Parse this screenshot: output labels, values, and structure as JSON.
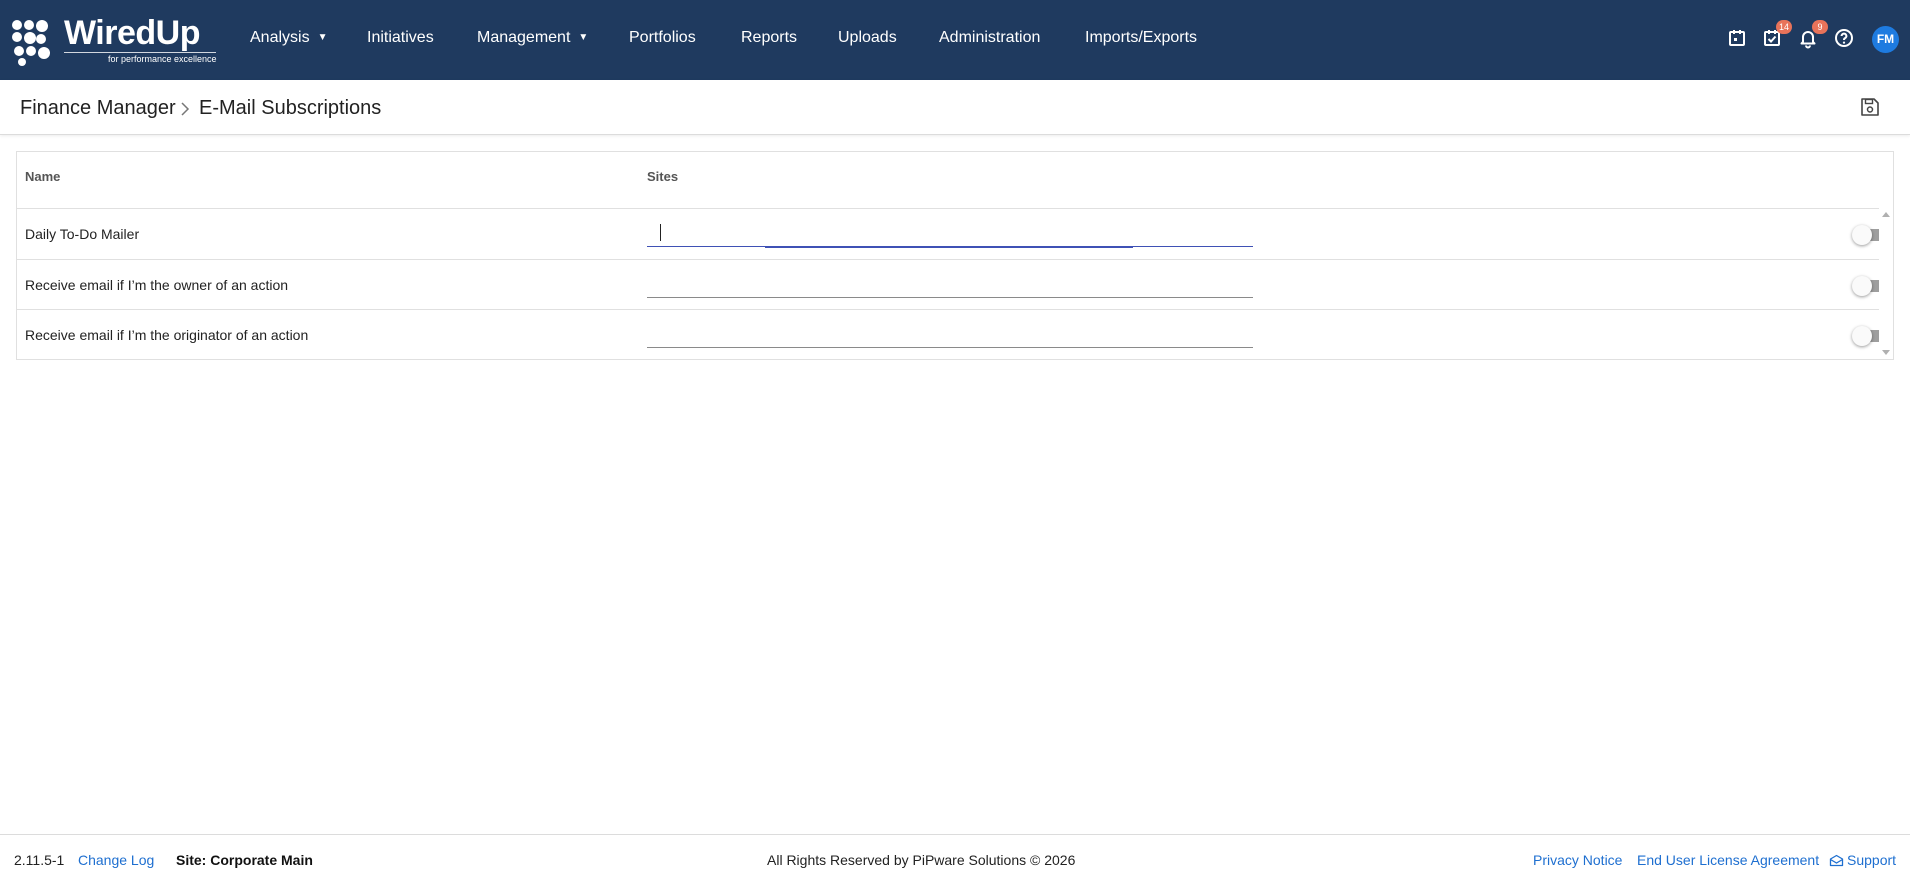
{
  "app": {
    "logo_text": "WiredUp",
    "logo_tagline": "for performance excellence"
  },
  "nav": {
    "items": [
      {
        "label": "Analysis",
        "has_dropdown": true
      },
      {
        "label": "Initiatives",
        "has_dropdown": false
      },
      {
        "label": "Management",
        "has_dropdown": true
      },
      {
        "label": "Portfolios",
        "has_dropdown": false
      },
      {
        "label": "Reports",
        "has_dropdown": false
      },
      {
        "label": "Uploads",
        "has_dropdown": false
      },
      {
        "label": "Administration",
        "has_dropdown": false
      },
      {
        "label": "Imports/Exports",
        "has_dropdown": false
      }
    ],
    "icons": {
      "calendar": "calendar-icon",
      "tasks": "task-check-icon",
      "notifications": "bell-icon",
      "help": "help-icon"
    },
    "tasks_badge": "14",
    "notifications_badge": "9",
    "avatar_initials": "FM",
    "avatar_color": "#1e7be0",
    "bar_color": "#1f3a5f",
    "badge_color": "#e8735a"
  },
  "breadcrumb": {
    "parent": "Finance Manager",
    "current": "E-Mail Subscriptions"
  },
  "table": {
    "headers": {
      "name": "Name",
      "sites": "Sites"
    },
    "rows": [
      {
        "name": "Daily To-Do Mailer",
        "sites_value": "",
        "enabled": false,
        "focused": true
      },
      {
        "name": "Receive email if I’m the owner of an action",
        "sites_value": "",
        "enabled": false,
        "focused": false
      },
      {
        "name": "Receive email if I’m the originator of an action",
        "sites_value": "",
        "enabled": false,
        "focused": false
      }
    ]
  },
  "footer": {
    "version": "2.11.5-1",
    "change_log": "Change Log",
    "site": "Site: Corporate Main",
    "rights": "All Rights Reserved by PiPware Solutions © 2026",
    "privacy": "Privacy Notice",
    "eula": "End User License Agreement",
    "support": "Support"
  }
}
